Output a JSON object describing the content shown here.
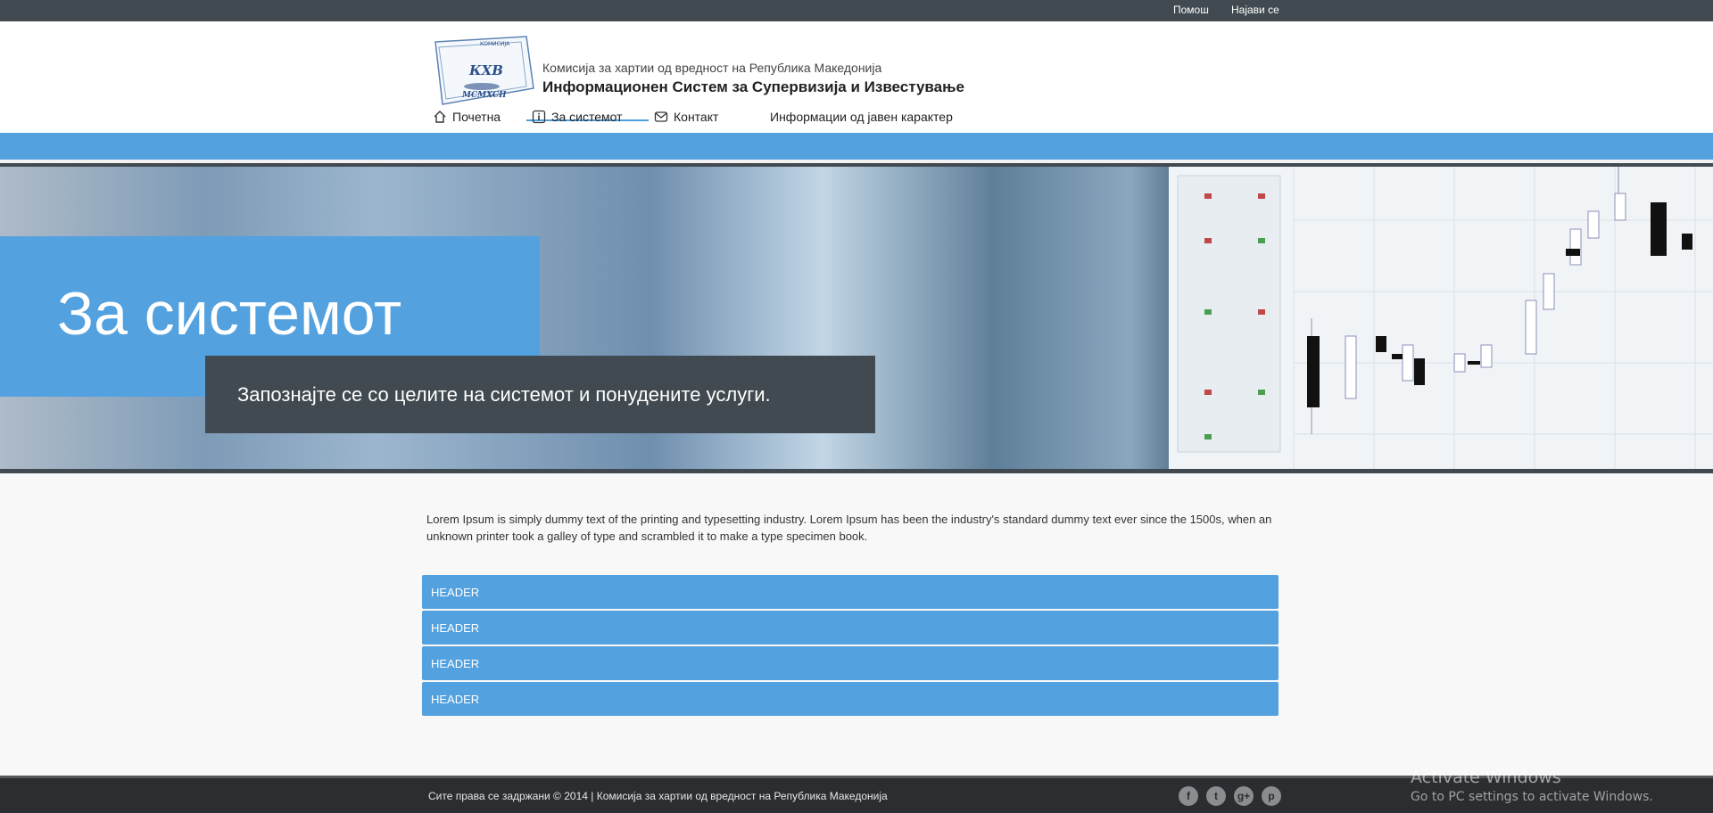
{
  "topbar": {
    "help": "Помош",
    "login": "Најави се"
  },
  "header": {
    "logo": {
      "text": "КХВ",
      "sub": "MCMXCII",
      "ring": "КОМИСИЈА"
    },
    "subtitle": "Комисија за хартии од вредност на Република Македонија",
    "title": "Информационен Систем за Супервизија и Известување"
  },
  "nav": {
    "items": [
      {
        "label": "Почетна",
        "icon": "home-icon"
      },
      {
        "label": "За системот",
        "icon": "info-icon",
        "active": true
      },
      {
        "label": "Контакт",
        "icon": "mail-icon"
      },
      {
        "label": "Информации од јавен карактер"
      }
    ]
  },
  "hero": {
    "title": "За системот",
    "subtitle": "Запознајте се со целите на системот и понудените услуги."
  },
  "content": {
    "intro": "Lorem Ipsum is simply dummy text of the printing and typesetting industry. Lorem Ipsum has been the industry's standard dummy text ever since the 1500s, when an unknown printer took a galley of type and scrambled it to make a type specimen book.",
    "accordion": [
      "HEADER",
      "HEADER",
      "HEADER",
      "HEADER"
    ]
  },
  "footer": {
    "copyright": "Сите права се задржани © 2014 | Комисија за хартии од вредност на Република Македонија",
    "social": [
      {
        "name": "facebook-icon",
        "glyph": "f"
      },
      {
        "name": "twitter-icon",
        "glyph": "t"
      },
      {
        "name": "google-plus-icon",
        "glyph": "g+"
      },
      {
        "name": "pinterest-icon",
        "glyph": "p"
      }
    ]
  },
  "watermark": {
    "line1": "Activate Windows",
    "line2": "Go to PC settings to activate Windows."
  },
  "colors": {
    "accent": "#53a1df",
    "dark": "#414a50",
    "footer": "#2a2e31"
  }
}
